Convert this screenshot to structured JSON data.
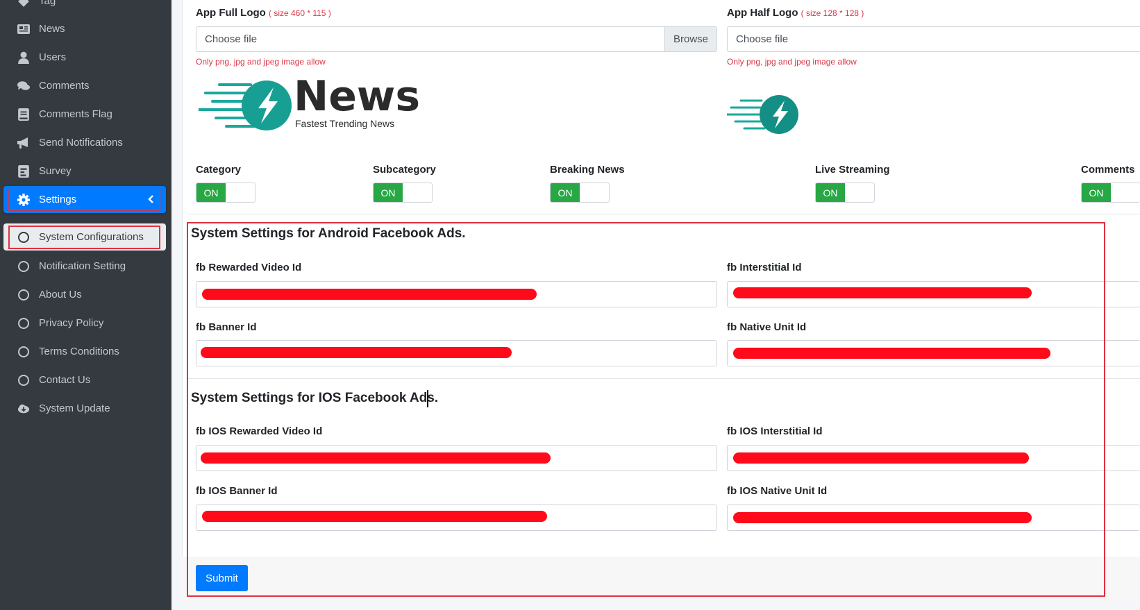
{
  "sidebar": {
    "items": [
      {
        "label": "Tag",
        "icon": "tag-icon"
      },
      {
        "label": "News",
        "icon": "newspaper-icon"
      },
      {
        "label": "Users",
        "icon": "user-icon"
      },
      {
        "label": "Comments",
        "icon": "comments-icon"
      },
      {
        "label": "Comments Flag",
        "icon": "book-icon"
      },
      {
        "label": "Send Notifications",
        "icon": "bullhorn-icon"
      },
      {
        "label": "Survey",
        "icon": "poll-icon"
      },
      {
        "label": "Settings",
        "icon": "gear-icon"
      },
      {
        "label": "System Configurations",
        "icon": "circle-icon"
      },
      {
        "label": "Notification Setting",
        "icon": "circle-icon"
      },
      {
        "label": "About Us",
        "icon": "circle-icon"
      },
      {
        "label": "Privacy Policy",
        "icon": "circle-icon"
      },
      {
        "label": "Terms Conditions",
        "icon": "circle-icon"
      },
      {
        "label": "Contact Us",
        "icon": "circle-icon"
      },
      {
        "label": "System Update",
        "icon": "cloud-download-icon"
      }
    ]
  },
  "logos": {
    "full_label": "App Full Logo",
    "full_hint": "( size 460 * 115 )",
    "half_label": "App Half Logo",
    "half_hint": "( size 128 * 128 )",
    "file_placeholder": "Choose file",
    "browse_label": "Browse",
    "note": "Only png, jpg and jpeg image allow",
    "brand_name": "News",
    "brand_tagline": "Fastest Trending News",
    "brand_color": "#1aa89c"
  },
  "toggles": [
    {
      "label": "Category",
      "state": "ON"
    },
    {
      "label": "Subcategory",
      "state": "ON"
    },
    {
      "label": "Breaking News",
      "state": "ON"
    },
    {
      "label": "Live Streaming",
      "state": "ON"
    },
    {
      "label": "Comments",
      "state": "ON"
    }
  ],
  "android": {
    "title": "System Settings for Android Facebook Ads.",
    "rewarded_label": "fb Rewarded Video Id",
    "interstitial_label": "fb Interstitial Id",
    "banner_label": "fb Banner Id",
    "native_label": "fb Native Unit Id"
  },
  "ios": {
    "title": "System Settings for IOS Facebook Ads.",
    "rewarded_label": "fb IOS Rewarded Video Id",
    "interstitial_label": "fb IOS Interstitial Id",
    "banner_label": "fb IOS Banner Id",
    "native_label": "fb IOS Native Unit Id"
  },
  "submit_label": "Submit",
  "colors": {
    "primary": "#007bff",
    "success": "#28a745",
    "danger": "#dc3545",
    "sidebar": "#343a40"
  }
}
